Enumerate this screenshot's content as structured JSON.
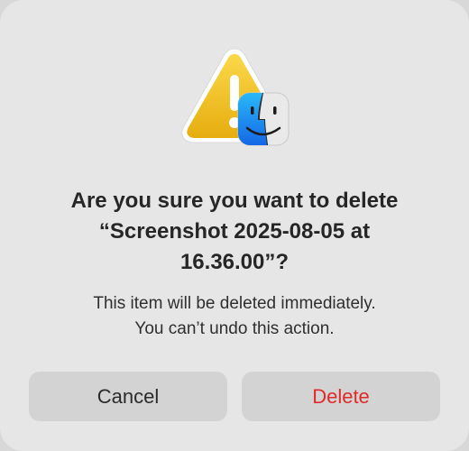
{
  "dialog": {
    "title_lines": [
      "Are you sure you want to delete",
      "“Screenshot 2025-08-05 at",
      "16.36.00”?"
    ],
    "message_lines": [
      "This item will be deleted immediately.",
      "You can’t undo this action."
    ],
    "cancel_label": "Cancel",
    "delete_label": "Delete",
    "icons": {
      "warning": "warning-triangle-icon",
      "app": "finder-icon"
    }
  },
  "colors": {
    "background": "#e6e6e6",
    "button": "#d3d3d3",
    "destructive": "#e02b2b",
    "warning": "#f2c21a"
  }
}
